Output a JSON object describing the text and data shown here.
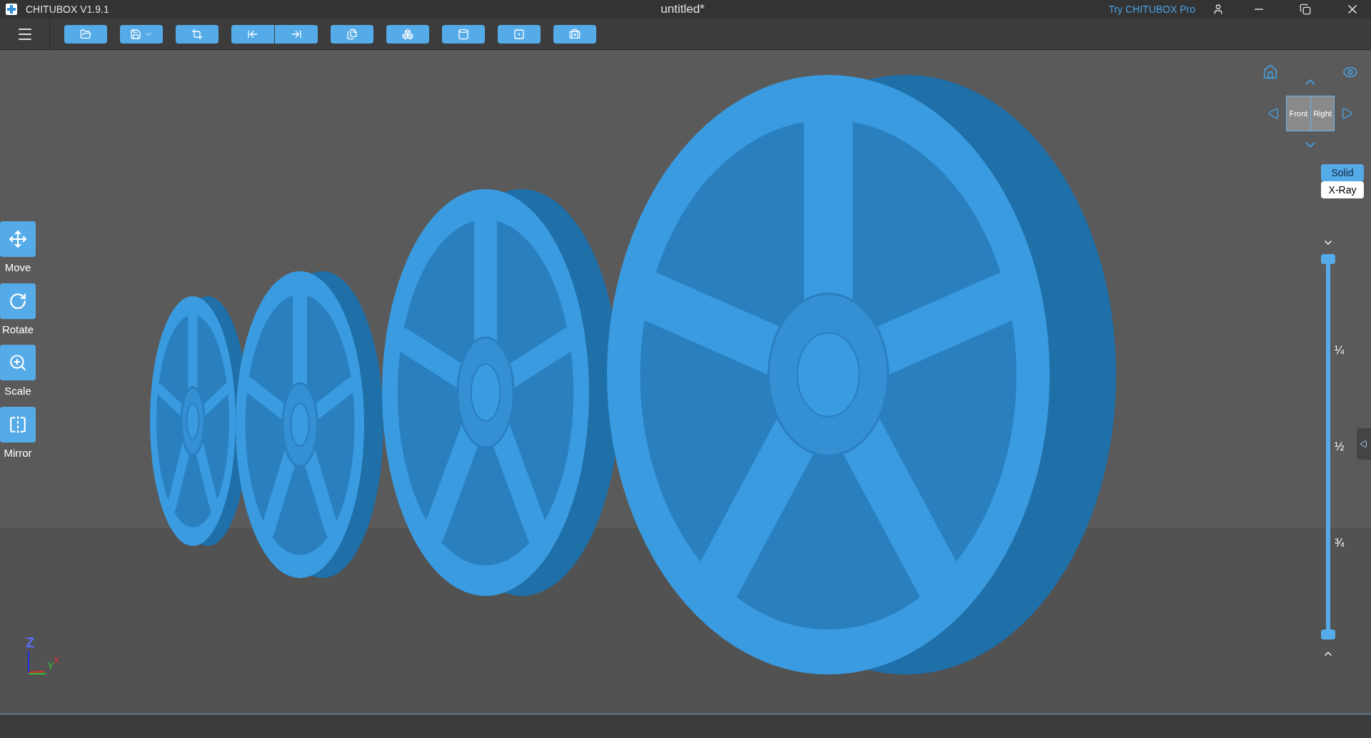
{
  "window": {
    "app_name": "CHITUBOX V1.9.1",
    "title": "untitled*",
    "promo_link": "Try CHITUBOX Pro"
  },
  "tools": [
    {
      "label": "Move",
      "kind": "move"
    },
    {
      "label": "Rotate",
      "kind": "rotate"
    },
    {
      "label": "Scale",
      "kind": "scale"
    },
    {
      "label": "Mirror",
      "kind": "mirror"
    }
  ],
  "view_cube": {
    "faces": [
      "Front",
      "Right"
    ]
  },
  "render_modes": [
    {
      "label": "Solid",
      "selected": true
    },
    {
      "label": "X-Ray",
      "selected": false
    }
  ],
  "layer_slider": {
    "level": 1,
    "marks": [
      "¼",
      "½",
      "¾"
    ]
  },
  "axes": [
    "Z",
    "Y",
    "X"
  ]
}
